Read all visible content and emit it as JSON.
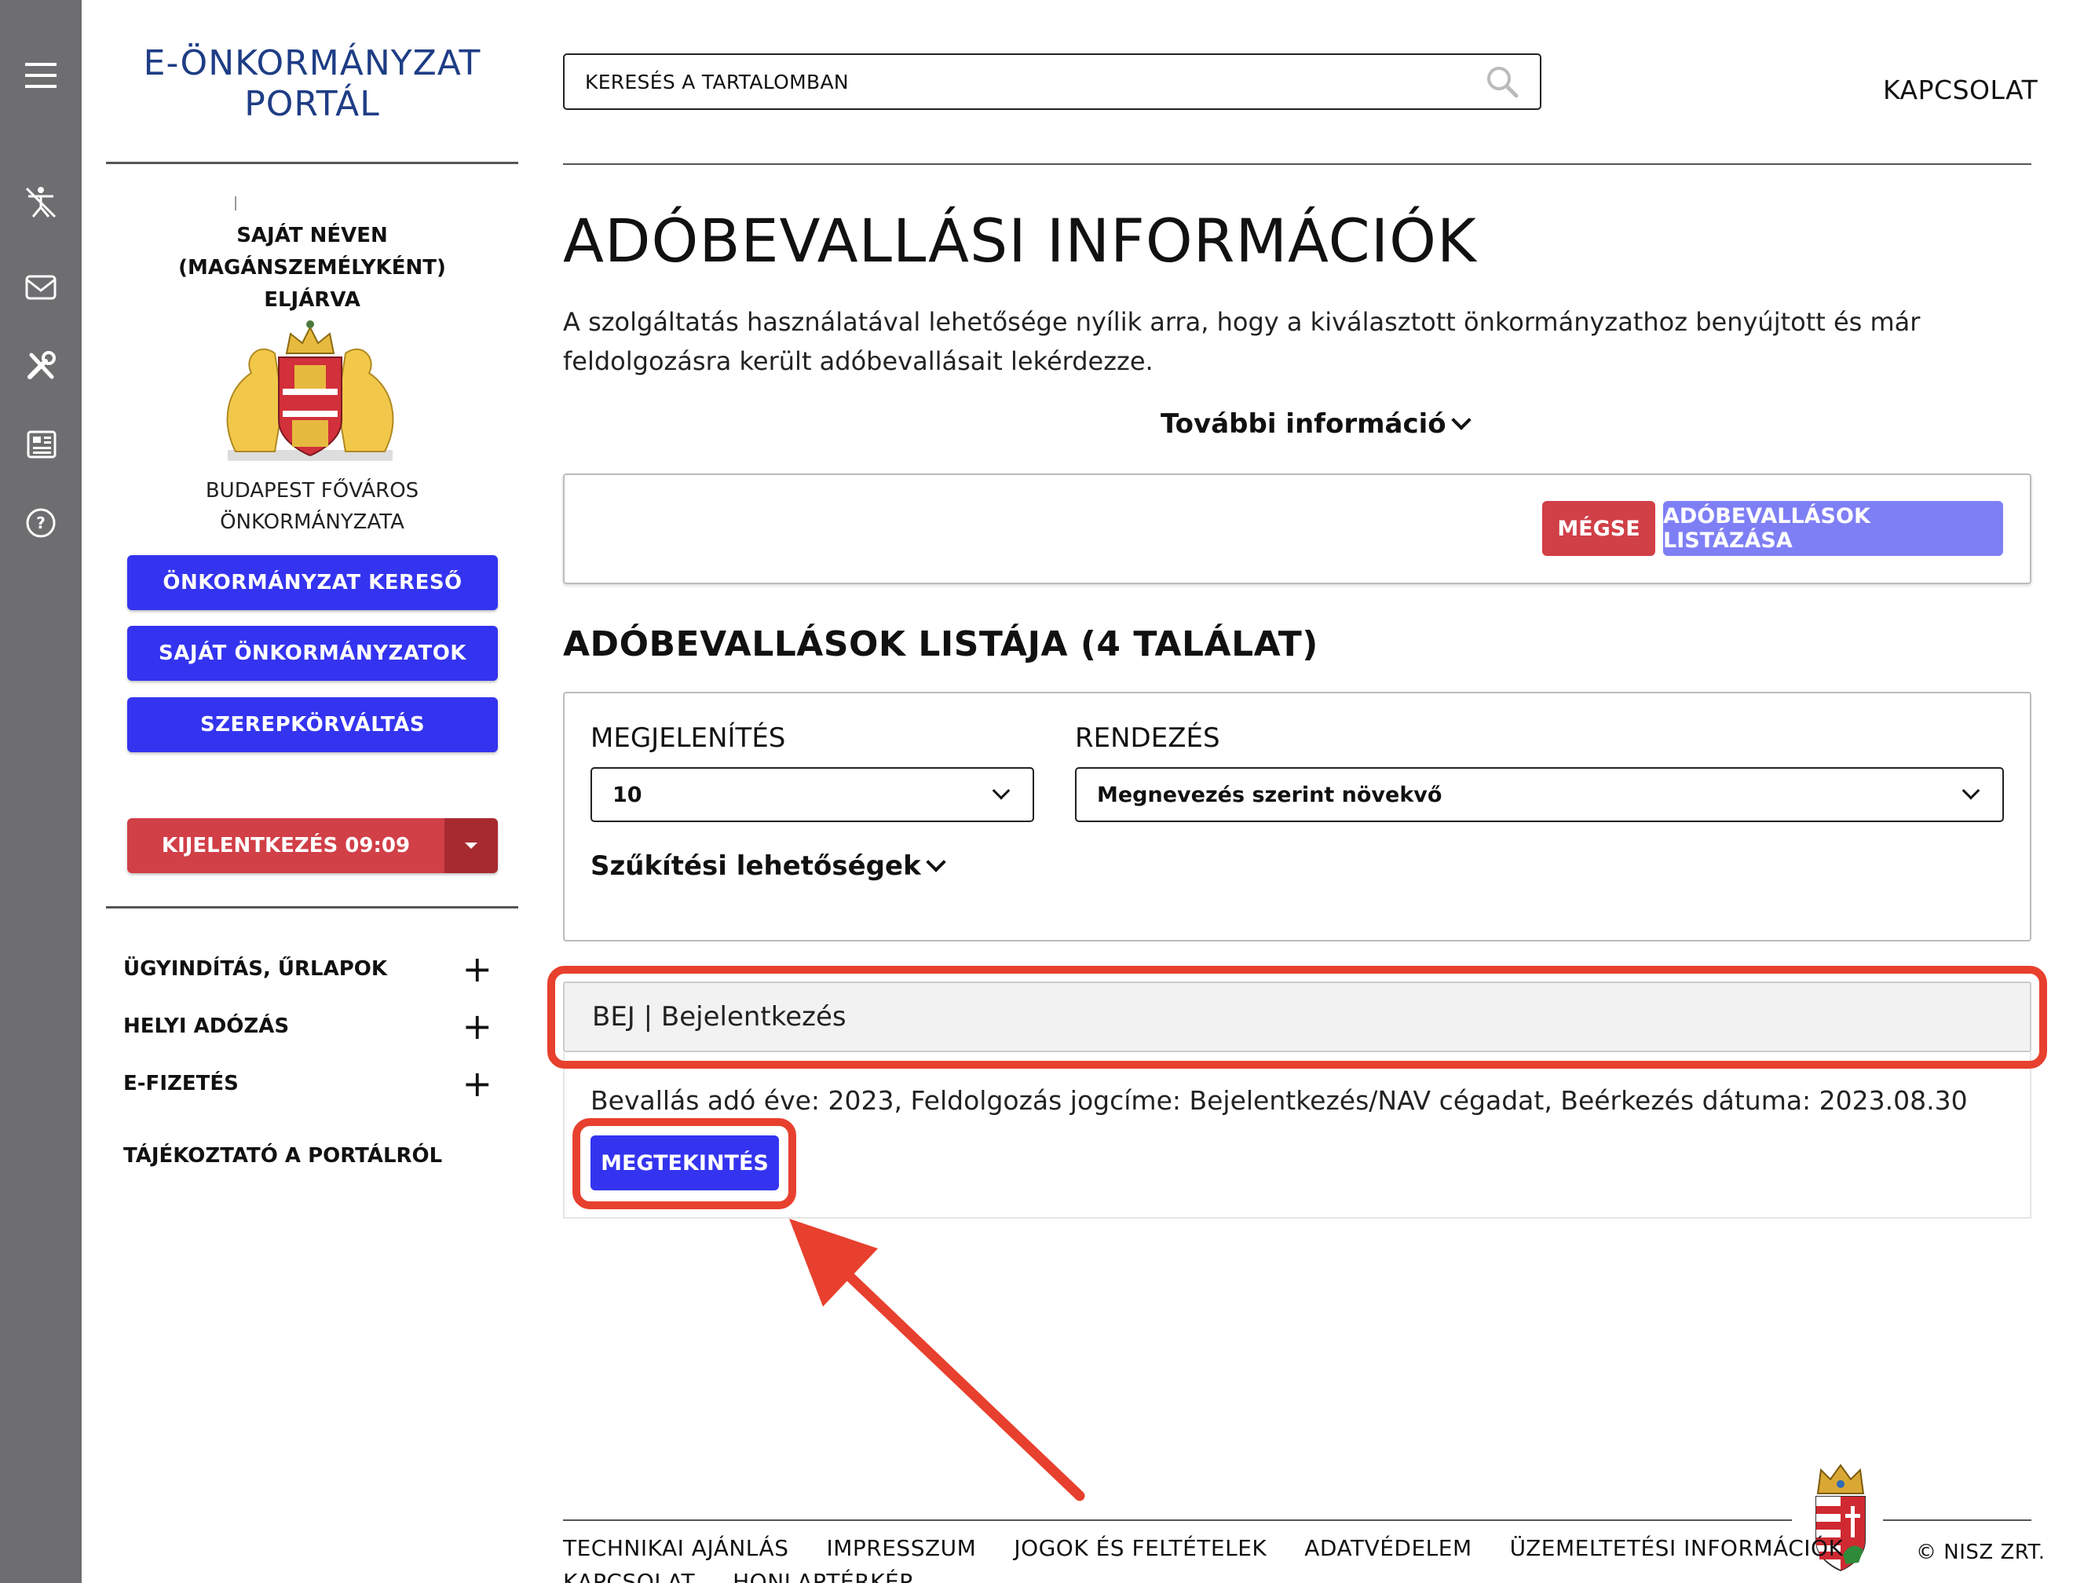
{
  "sidebar": {
    "portal_title_line1": "E-ÖNKORMÁNYZAT",
    "portal_title_line2": "PORTÁL",
    "role_line1": "SAJÁT NÉVEN (MAGÁNSZEMÉLYKÉNT)",
    "role_line2": "ELJÁRVA",
    "municipality_line1": "BUDAPEST FŐVÁROS",
    "municipality_line2": "ÖNKORMÁNYZATA",
    "buttons": {
      "search_municipality": "ÖNKORMÁNYZAT KERESŐ",
      "own_municipalities": "SAJÁT ÖNKORMÁNYZATOK",
      "role_switch": "SZEREPKÖRVÁLTÁS",
      "logout": "KIJELENTKEZÉS 09:09"
    },
    "menu": [
      {
        "label": "ÜGYINDÍTÁS, ŰRLAPOK",
        "expand": "+"
      },
      {
        "label": "HELYI ADÓZÁS",
        "expand": "+"
      },
      {
        "label": "E-FIZETÉS",
        "expand": "+"
      },
      {
        "label": "TÁJÉKOZTATÓ A PORTÁLRÓL"
      }
    ]
  },
  "header": {
    "search_placeholder": "KERESÉS A TARTALOMBAN",
    "contact": "KAPCSOLAT"
  },
  "main": {
    "title": "ADÓBEVALLÁSI INFORMÁCIÓK",
    "description": "A szolgáltatás használatával lehetősége nyílik arra, hogy a kiválasztott önkormányzathoz benyújtott és már feldolgozásra került adóbevallásait lekérdezze.",
    "more_info": "További információ",
    "cancel_button": "MÉGSE",
    "list_button": "ADÓBEVALLÁSOK LISTÁZÁSA",
    "list_title": "ADÓBEVALLÁSOK LISTÁJA (4 TALÁLAT)",
    "display_label": "MEGJELENÍTÉS",
    "display_value": "10",
    "sort_label": "RENDEZÉS",
    "sort_value": "Megnevezés szerint növekvő",
    "filter_options": "Szűkítési lehetőségek",
    "result": {
      "header": "BEJ | Bejelentkezés",
      "info": "Bevallás adó éve: 2023, Feldolgozás jogcíme: Bejelentkezés/NAV cégadat, Beérkezés dátuma: 2023.08.30",
      "view_button": "MEGTEKINTÉS"
    }
  },
  "footer": {
    "links": [
      "TECHNIKAI AJÁNLÁS",
      "IMPRESSZUM",
      "JOGOK ÉS FELTÉTELEK",
      "ADATVÉDELEM",
      "ÜZEMELTETÉSI INFORMÁCIÓK"
    ],
    "links_row2": [
      "KAPCSOLAT",
      "HONLAPTÉRKÉP"
    ],
    "copyright": "© NISZ ZRT."
  },
  "colors": {
    "primary": "#3434f0",
    "danger": "#d13f47",
    "rail": "#6e6e70",
    "highlight": "#e8402e",
    "title": "#1e3d85"
  }
}
